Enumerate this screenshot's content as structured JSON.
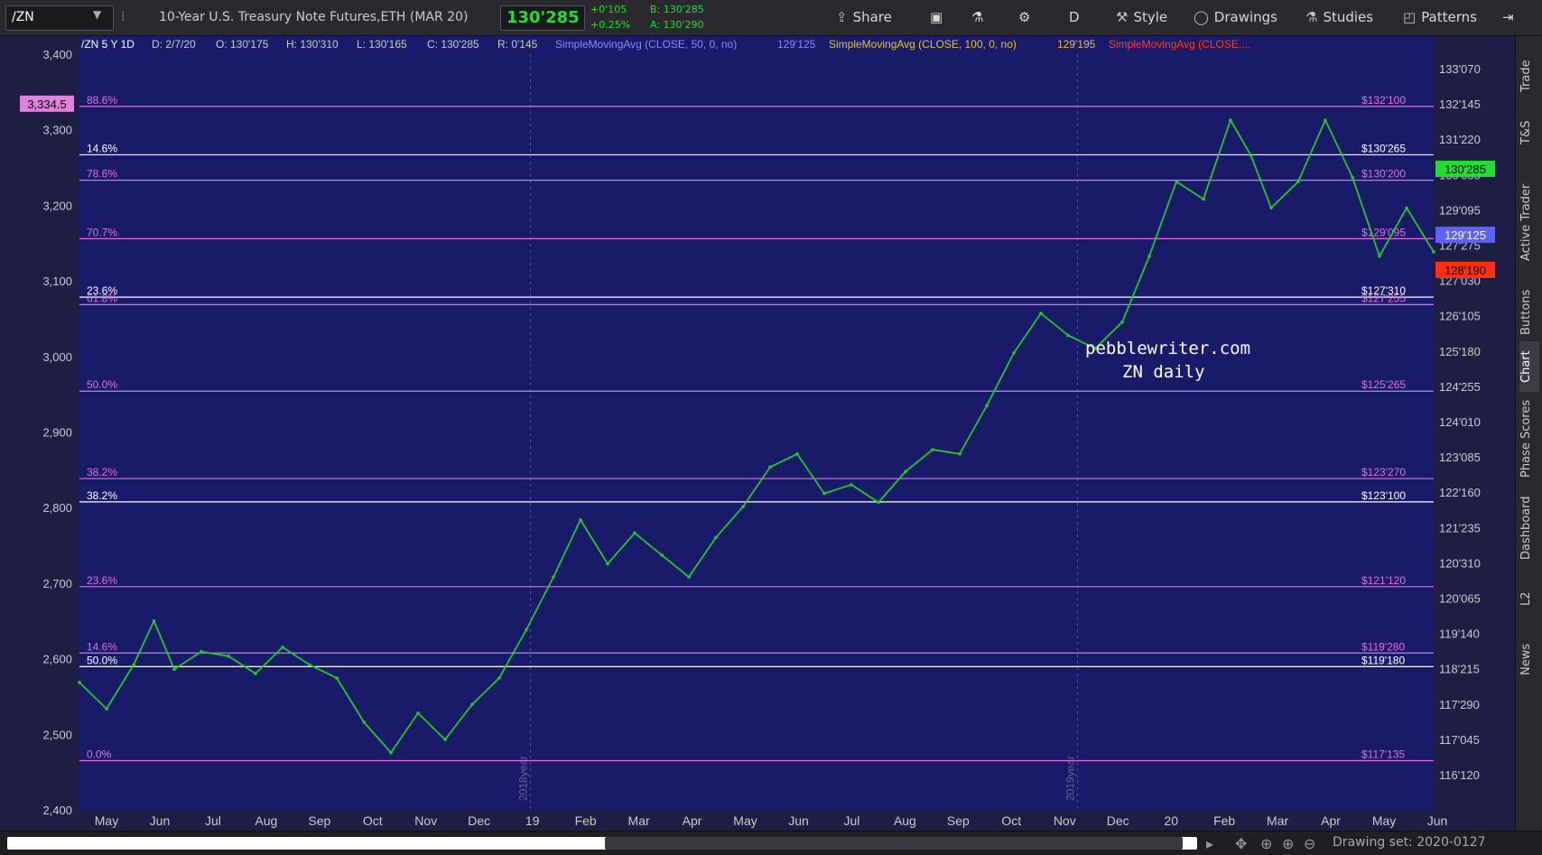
{
  "toolbar": {
    "symbol": "/ZN",
    "description": "10-Year U.S. Treasury Note Futures,ETH (MAR 20)",
    "last": "130'285",
    "change": "+0'105",
    "change_pct": "+0.25%",
    "bid": "B: 130'285",
    "ask": "A: 130'290",
    "buttons": [
      "Share",
      "D",
      "Style",
      "Drawings",
      "Studies",
      "Patterns"
    ],
    "colors": {
      "up": "#22dd33",
      "bg": "#2a2a2e"
    }
  },
  "side_tabs": [
    "Trade",
    "T&S",
    "Active Trader",
    "Buttons",
    "Chart",
    "Phase Scores",
    "Dashboard",
    "L2",
    "News"
  ],
  "bottom": {
    "drawing_set": "Drawing set: 2020-0127"
  },
  "chart_data": {
    "type": "line",
    "header": {
      "symbol_period": "/ZN 5 Y 1D",
      "date": "D: 2/7/20",
      "open": "O: 130'175",
      "high": "H: 130'310",
      "low": "L: 130'165",
      "close": "C: 130'285",
      "range": "R: 0'145",
      "studies": [
        {
          "label": "SimpleMovingAvg (CLOSE, 50, 0, no)",
          "value": "129'125",
          "color": "#8a8aff"
        },
        {
          "label": "SimpleMovingAvg (CLOSE, 100, 0, no)",
          "value": "129'195",
          "color": "#e0c040"
        },
        {
          "label": "SimpleMovingAvg (CLOSE,...",
          "value": "",
          "color": "#ff4020"
        }
      ]
    },
    "annotation": [
      "pebblewriter.com",
      "ZN daily"
    ],
    "x_months": [
      "May",
      "Jun",
      "Jul",
      "Aug",
      "Sep",
      "Oct",
      "Nov",
      "Dec",
      "19",
      "Feb",
      "Mar",
      "Apr",
      "May",
      "Jun",
      "Jul",
      "Aug",
      "Sep",
      "Oct",
      "Nov",
      "Dec",
      "20",
      "Feb",
      "Mar",
      "Apr",
      "May",
      "Jun"
    ],
    "year_labels": [
      "2018year",
      "2019year"
    ],
    "x_range": [
      0,
      100
    ],
    "left_axis": {
      "ticks": [
        "3,400",
        "3,300",
        "3,200",
        "3,100",
        "3,000",
        "2,900",
        "2,800",
        "2,700",
        "2,600",
        "2,500",
        "2,400"
      ],
      "highlight": "3,334.5",
      "range": [
        2400,
        3400
      ]
    },
    "right_axis": {
      "ticks": [
        "133'070",
        "132'145",
        "131'220",
        "130'050",
        "129'095",
        "127'275",
        "127'030",
        "126'105",
        "125'180",
        "124'255",
        "124'010",
        "123'085",
        "122'160",
        "121'235",
        "120'310",
        "120'065",
        "119'140",
        "118'215",
        "117'290",
        "117'045",
        "116'120"
      ],
      "range": [
        116.3,
        133.5
      ]
    },
    "price_badges": [
      {
        "text": "130'285",
        "value": 130.89,
        "bg": "#22dd33",
        "fg": "#000000"
      },
      {
        "text": "129'125",
        "value": 129.39,
        "bg": "#6060ff",
        "fg": "#ffffff"
      },
      {
        "text": "128'190",
        "value": 128.59,
        "bg": "#ff3010",
        "fg": "#000000"
      }
    ],
    "fib_lines": [
      {
        "left": "88.6%",
        "right": "$132'100",
        "value": 132.31,
        "color": "#e070e0"
      },
      {
        "left": "14.6%",
        "right": "$130'265",
        "value": 131.21,
        "color": "#ffffff"
      },
      {
        "left": "78.6%",
        "right": "$130'200",
        "value": 130.63,
        "color": "#e070e0"
      },
      {
        "left": "70.7%",
        "right": "$129'095",
        "value": 129.3,
        "color": "#e070e0"
      },
      {
        "left": "23.6%",
        "right": "$127'310",
        "value": 127.97,
        "color": "#ffffff"
      },
      {
        "left": "61.8%",
        "right": "$127'255",
        "value": 127.8,
        "color": "#e070e0"
      },
      {
        "left": "50.0%",
        "right": "$125'265",
        "value": 125.83,
        "color": "#e070e0"
      },
      {
        "left": "38.2%",
        "right": "$123'270",
        "value": 123.84,
        "color": "#e070e0"
      },
      {
        "left": "38.2%",
        "right": "$123'100",
        "value": 123.31,
        "color": "#ffffff"
      },
      {
        "left": "23.6%",
        "right": "$121'120",
        "value": 121.38,
        "color": "#e070e0"
      },
      {
        "left": "14.6%",
        "right": "$119'280",
        "value": 119.87,
        "color": "#e070e0"
      },
      {
        "left": "50.0%",
        "right": "$119'180",
        "value": 119.56,
        "color": "#ffffff"
      },
      {
        "left": "0.0%",
        "right": "$117'135",
        "value": 117.42,
        "color": "#e070e0"
      }
    ],
    "series": [
      {
        "name": "",
        "color": "#22cc22",
        "values": [
          [
            0,
            119.2
          ],
          [
            2,
            118.6
          ],
          [
            4,
            119.6
          ],
          [
            5.5,
            120.6
          ],
          [
            7,
            119.5
          ],
          [
            9,
            119.9
          ],
          [
            11,
            119.8
          ],
          [
            13,
            119.4
          ],
          [
            15,
            120.0
          ],
          [
            17,
            119.6
          ],
          [
            19,
            119.3
          ],
          [
            21,
            118.3
          ],
          [
            23,
            117.6
          ],
          [
            25,
            118.5
          ],
          [
            27,
            117.9
          ],
          [
            29,
            118.7
          ],
          [
            31,
            119.3
          ],
          [
            33,
            120.4
          ],
          [
            35,
            121.6
          ],
          [
            37,
            122.9
          ],
          [
            39,
            121.9
          ],
          [
            41,
            122.6
          ],
          [
            43,
            122.1
          ],
          [
            45,
            121.6
          ],
          [
            47,
            122.5
          ],
          [
            49,
            123.2
          ],
          [
            51,
            124.1
          ],
          [
            53,
            124.4
          ],
          [
            55,
            123.5
          ],
          [
            57,
            123.7
          ],
          [
            59,
            123.3
          ],
          [
            61,
            124.0
          ],
          [
            63,
            124.5
          ],
          [
            65,
            124.4
          ],
          [
            67,
            125.5
          ],
          [
            69,
            126.7
          ],
          [
            71,
            127.6
          ],
          [
            73,
            127.1
          ],
          [
            75,
            126.8
          ],
          [
            77,
            127.4
          ],
          [
            79,
            128.9
          ],
          [
            81,
            130.6
          ],
          [
            83,
            130.2
          ],
          [
            85,
            132.0
          ],
          [
            86.5,
            131.2
          ],
          [
            88,
            130.0
          ],
          [
            90,
            130.6
          ],
          [
            92,
            132.0
          ],
          [
            94,
            130.7
          ],
          [
            96,
            128.9
          ],
          [
            98,
            130.0
          ],
          [
            100,
            129.0
          ]
        ]
      }
    ]
  }
}
